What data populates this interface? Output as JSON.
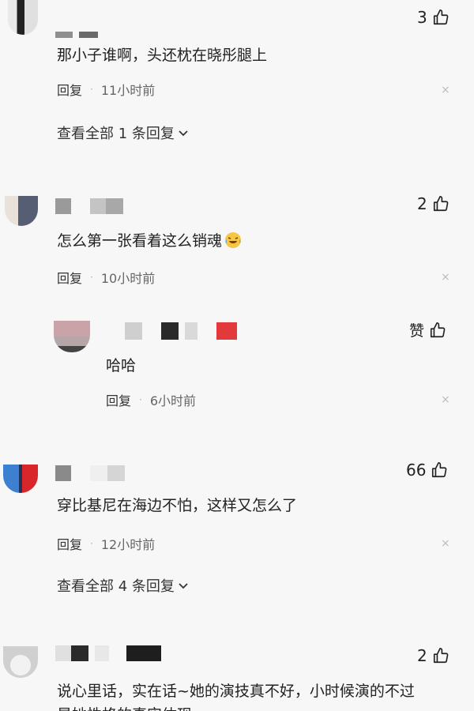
{
  "comments": [
    {
      "likes": "3",
      "text": "那小子谁啊，头还枕在晓彤腿上",
      "reply_label": "回复",
      "time": "11小时前",
      "view_all": "查看全部 1 条回复"
    },
    {
      "likes": "2",
      "text": "怎么第一张看着这么销魂",
      "reply_label": "回复",
      "time": "10小时前",
      "emoji": "laughing-crying-emoji"
    },
    {
      "likes": "66",
      "text": "穿比基尼在海边不怕，这样又怎么了",
      "reply_label": "回复",
      "time": "12小时前",
      "view_all": "查看全部 4 条回复"
    },
    {
      "likes": "2",
      "text": "说心里话，实在话~她的演技真不好，小时候演的不过",
      "text_line2": "是她性格的真实体现"
    }
  ],
  "reply": {
    "likes": "赞",
    "text": "哈哈",
    "reply_label": "回复",
    "time": "6小时前"
  },
  "icons": {
    "like": "thumbs-up-icon",
    "close": "close-icon",
    "chevron": "chevron-down-icon"
  },
  "colors": {
    "background": "#f7f7f7",
    "text": "#222222",
    "meta": "#666666",
    "red_block": "#e23a3a"
  }
}
